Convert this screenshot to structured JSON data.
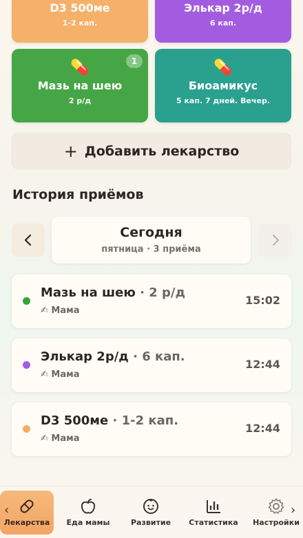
{
  "medicines": [
    {
      "name": "D3 500ме",
      "dose": "1-2 кап.",
      "color": "#f5b06a",
      "icon": "pill-icon",
      "badge": ""
    },
    {
      "name": "Элькар 2р/д",
      "dose": "6 кап.",
      "color": "#a35ce0",
      "icon": "pill-icon",
      "badge": ""
    },
    {
      "name": "Мазь на шею",
      "dose": "2 р/д",
      "color": "#46a646",
      "icon": "pill-icon",
      "badge": "1"
    },
    {
      "name": "Биоамикус",
      "dose": "5 кап. 7 дней. Вечер.",
      "color": "#2aa08f",
      "icon": "pill-icon",
      "badge": ""
    }
  ],
  "add_button": {
    "plus": "+",
    "label": "Добавить лекарство"
  },
  "history": {
    "title": "История приёмов",
    "date_title": "Сегодня",
    "date_subtitle": "пятница · 3 приёма",
    "entries": [
      {
        "name": "Мазь на шею",
        "separator": " · ",
        "dose": "2 р/д",
        "who": "✍ Мама",
        "time": "15:02",
        "color": "#3aa33a"
      },
      {
        "name": "Элькар 2р/д",
        "separator": " · ",
        "dose": "6 кап.",
        "who": "✍ Мама",
        "time": "12:44",
        "color": "#a35ce0"
      },
      {
        "name": "D3 500ме",
        "separator": " · ",
        "dose": "1-2 кап.",
        "who": "✍ Мама",
        "time": "12:44",
        "color": "#f2ad66"
      }
    ]
  },
  "nav": {
    "items": [
      {
        "label": "Лекарства",
        "icon": "pill-icon"
      },
      {
        "label": "Еда мамы",
        "icon": "apple-icon"
      },
      {
        "label": "Развитие",
        "icon": "baby-face-icon"
      },
      {
        "label": "Статистика",
        "icon": "bar-chart-icon"
      },
      {
        "label": "Настройки",
        "icon": "gear-icon"
      }
    ],
    "left_arrow": "‹",
    "right_arrow": "›"
  }
}
